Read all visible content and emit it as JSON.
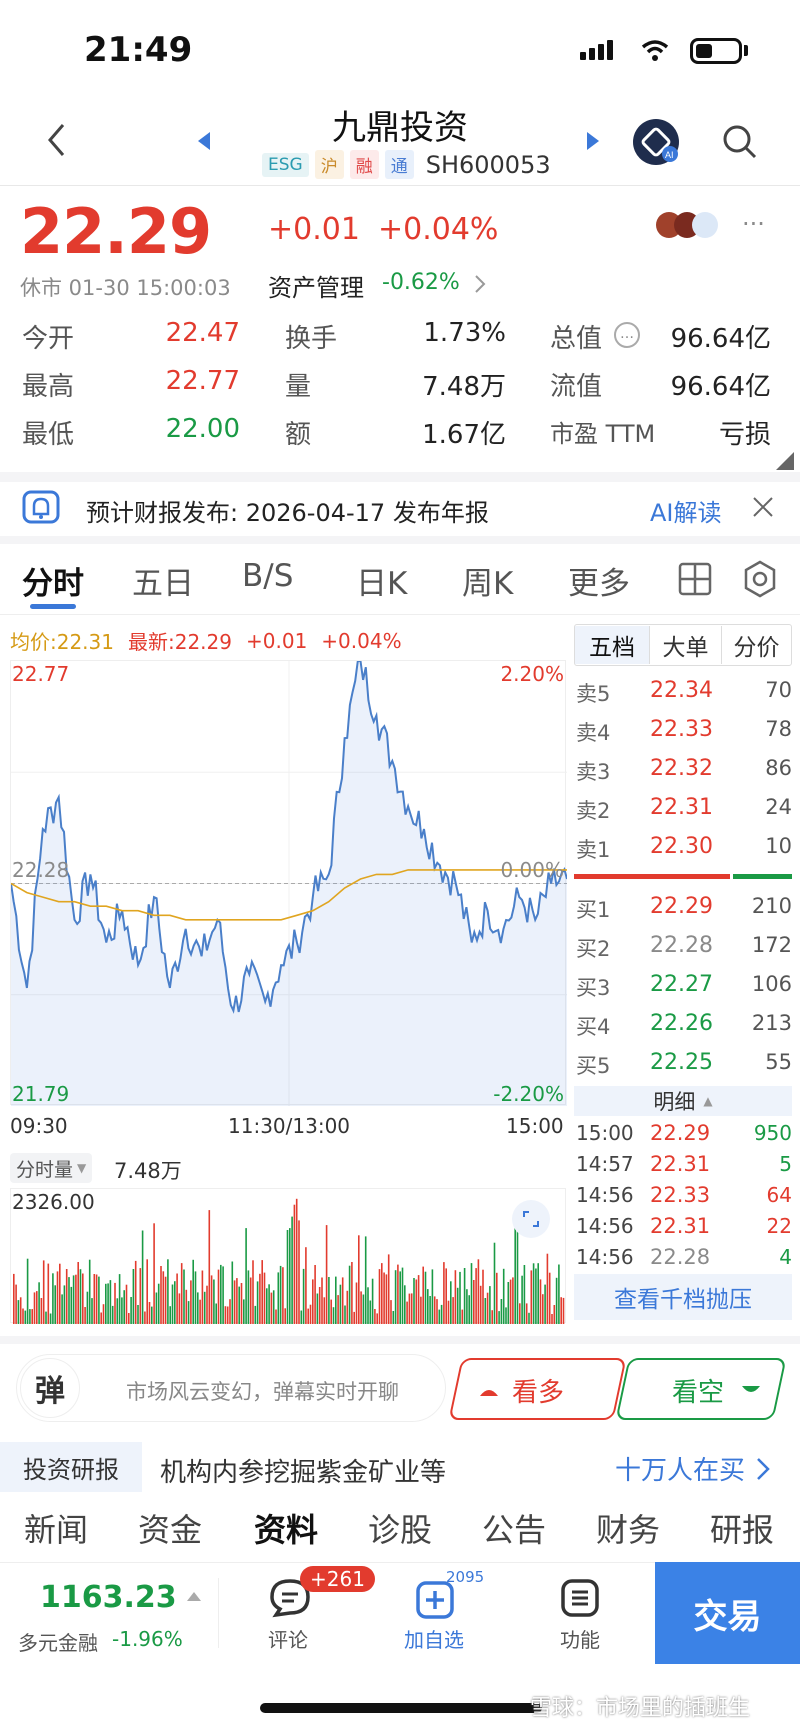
{
  "status_bar": {
    "time": "21:49"
  },
  "header": {
    "title": "九鼎投资",
    "tags": [
      "ESG",
      "沪",
      "融",
      "通"
    ],
    "code": "SH600053"
  },
  "quote": {
    "price": "22.29",
    "change": "+0.01",
    "change_pct": "+0.04%",
    "market_status": "休市 01-30 15:00:03",
    "sector": "资产管理",
    "sector_change": "-0.62%",
    "more": "···",
    "stats": [
      {
        "label": "今开",
        "value": "22.47",
        "color": "red"
      },
      {
        "label": "换手",
        "value": "1.73%",
        "color": "black"
      },
      {
        "label": "总值",
        "value": "96.64亿",
        "color": "black"
      },
      {
        "label": "最高",
        "value": "22.77",
        "color": "red"
      },
      {
        "label": "量",
        "value": "7.48万",
        "color": "black"
      },
      {
        "label": "流值",
        "value": "96.64亿",
        "color": "black"
      },
      {
        "label": "最低",
        "value": "22.00",
        "color": "green"
      },
      {
        "label": "额",
        "value": "1.67亿",
        "color": "black"
      },
      {
        "label": "市盈 TTM",
        "value": "亏损",
        "color": "black"
      }
    ]
  },
  "notice": {
    "text": "预计财报发布: 2026-04-17 发布年报",
    "ai_label": "AI解读"
  },
  "chart_tabs": [
    "分时",
    "五日",
    "B/S",
    "日K",
    "周K",
    "更多"
  ],
  "intraday": {
    "avg_label": "均价:22.31",
    "latest_label": "最新:22.29",
    "latest_change": "+0.01",
    "latest_pct": "+0.04%",
    "y_high": "22.77",
    "y_mid": "22.28",
    "y_low": "21.79",
    "pct_high": "2.20%",
    "pct_mid": "0.00%",
    "pct_low": "-2.20%",
    "time_start": "09:30",
    "time_mid": "11:30/13:00",
    "time_end": "15:00",
    "volume_selector": "分时量",
    "volume_total": "7.48万",
    "volume_max": "2326.00"
  },
  "chart_data": {
    "type": "line",
    "x_range": [
      "09:30",
      "15:00"
    ],
    "ylim": [
      21.79,
      22.77
    ],
    "series": [
      {
        "name": "最新",
        "values": [
          22.28,
          22.05,
          22.4,
          22.47,
          22.2,
          22.3,
          22.15,
          22.22,
          22.1,
          22.25,
          22.05,
          22.18,
          22.12,
          22.2,
          22.0,
          22.08,
          22.02,
          22.1,
          22.15,
          22.25,
          22.3,
          22.6,
          22.77,
          22.65,
          22.55,
          22.45,
          22.4,
          22.32,
          22.28,
          22.15,
          22.22,
          22.18,
          22.25,
          22.2,
          22.28,
          22.29
        ]
      },
      {
        "name": "均价",
        "values": [
          22.28,
          22.26,
          22.25,
          22.24,
          22.24,
          22.23,
          22.23,
          22.22,
          22.22,
          22.21,
          22.21,
          22.2,
          22.2,
          22.2,
          22.2,
          22.2,
          22.2,
          22.2,
          22.21,
          22.22,
          22.24,
          22.27,
          22.29,
          22.3,
          22.3,
          22.31,
          22.31,
          22.31,
          22.31,
          22.31,
          22.31,
          22.31,
          22.31,
          22.31,
          22.31,
          22.31
        ]
      }
    ]
  },
  "order_book": {
    "tabs": [
      "五档",
      "大单",
      "分价"
    ],
    "asks": [
      {
        "label": "卖5",
        "price": "22.34",
        "vol": "70"
      },
      {
        "label": "卖4",
        "price": "22.33",
        "vol": "78"
      },
      {
        "label": "卖3",
        "price": "22.32",
        "vol": "86"
      },
      {
        "label": "卖2",
        "price": "22.31",
        "vol": "24"
      },
      {
        "label": "卖1",
        "price": "22.30",
        "vol": "10"
      }
    ],
    "bids": [
      {
        "label": "买1",
        "price": "22.29",
        "vol": "210",
        "color": "red"
      },
      {
        "label": "买2",
        "price": "22.28",
        "vol": "172",
        "color": "gray"
      },
      {
        "label": "买3",
        "price": "22.27",
        "vol": "106",
        "color": "green"
      },
      {
        "label": "买4",
        "price": "22.26",
        "vol": "213",
        "color": "green"
      },
      {
        "label": "买5",
        "price": "22.25",
        "vol": "55",
        "color": "green"
      }
    ],
    "detail_label": "明细",
    "trades": [
      {
        "time": "15:00",
        "price": "22.29",
        "vol": "950",
        "pcolor": "red",
        "vcolor": "green"
      },
      {
        "time": "14:57",
        "price": "22.31",
        "vol": "5",
        "pcolor": "red",
        "vcolor": "green"
      },
      {
        "time": "14:56",
        "price": "22.33",
        "vol": "64",
        "pcolor": "red",
        "vcolor": "red"
      },
      {
        "time": "14:56",
        "price": "22.31",
        "vol": "22",
        "pcolor": "red",
        "vcolor": "red"
      },
      {
        "time": "14:56",
        "price": "22.28",
        "vol": "4",
        "pcolor": "gray",
        "vcolor": "green"
      }
    ],
    "depth_button": "查看千档抛压"
  },
  "danmu": {
    "icon_char": "弹",
    "placeholder": "市场风云变幻，弹幕实时开聊",
    "bull": "看多",
    "bear": "看空"
  },
  "research": {
    "tag": "投资研报",
    "text": "机构内参挖掘紫金矿业等",
    "link": "十万人在买"
  },
  "bottom_tabs": [
    "新闻",
    "资金",
    "资料",
    "诊股",
    "公告",
    "财务",
    "研报"
  ],
  "footer": {
    "index_value": "1163.23",
    "index_name": "多元金融",
    "index_change": "-1.96%",
    "comment_label": "评论",
    "comment_badge": "+261",
    "watch_label": "加自选",
    "watch_count": "2095",
    "func_label": "功能",
    "trade_label": "交易"
  },
  "watermark": "雪球：市场里的插班生",
  "colors": {
    "up": "#e23b2e",
    "down": "#1a9a45",
    "accent": "#3b78d8",
    "avg_line": "#e0a520"
  }
}
